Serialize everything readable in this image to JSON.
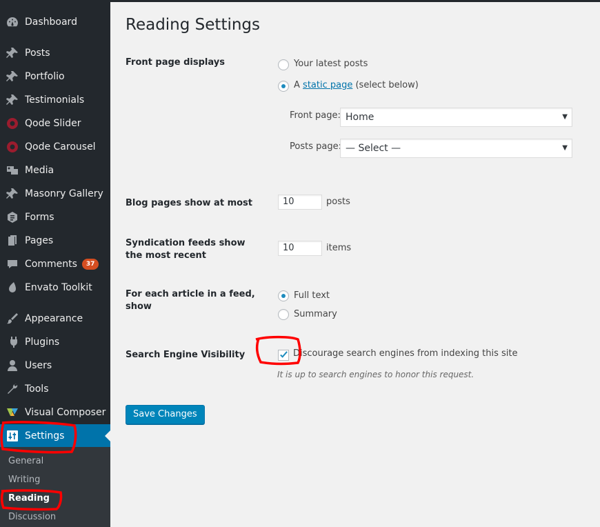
{
  "sidebar": {
    "items": [
      {
        "label": "Dashboard",
        "icon": "dashboard-icon"
      },
      {
        "label": "Posts",
        "icon": "pin-icon"
      },
      {
        "label": "Portfolio",
        "icon": "pin-icon"
      },
      {
        "label": "Testimonials",
        "icon": "pin-icon"
      },
      {
        "label": "Qode Slider",
        "icon": "circle-icon"
      },
      {
        "label": "Qode Carousel",
        "icon": "circle-icon"
      },
      {
        "label": "Media",
        "icon": "media-icon"
      },
      {
        "label": "Masonry Gallery",
        "icon": "pin-icon"
      },
      {
        "label": "Forms",
        "icon": "forms-icon"
      },
      {
        "label": "Pages",
        "icon": "pages-icon"
      },
      {
        "label": "Comments",
        "icon": "comment-icon",
        "badge": "37"
      },
      {
        "label": "Envato Toolkit",
        "icon": "leaf-icon"
      },
      {
        "label": "Appearance",
        "icon": "brush-icon"
      },
      {
        "label": "Plugins",
        "icon": "plugin-icon"
      },
      {
        "label": "Users",
        "icon": "user-icon"
      },
      {
        "label": "Tools",
        "icon": "wrench-icon"
      },
      {
        "label": "Visual Composer",
        "icon": "vc-icon"
      },
      {
        "label": "Settings",
        "icon": "settings-icon",
        "active": true
      }
    ],
    "submenu": [
      "General",
      "Writing",
      "Reading",
      "Discussion"
    ],
    "current_submenu": "Reading"
  },
  "page": {
    "title": "Reading Settings",
    "front_page_displays": {
      "label": "Front page displays",
      "option_latest": "Your latest posts",
      "option_static_prefix": "A",
      "option_static_link": "static page",
      "option_static_suffix": "(select below)",
      "selected": "static",
      "front_page_label": "Front page:",
      "front_page_value": "Home",
      "posts_page_label": "Posts page:",
      "posts_page_value": "— Select —"
    },
    "blog_pages": {
      "label": "Blog pages show at most",
      "value": "10",
      "unit": "posts"
    },
    "syndication": {
      "label": "Syndication feeds show the most recent",
      "value": "10",
      "unit": "items"
    },
    "feed_article": {
      "label": "For each article in a feed, show",
      "option_full": "Full text",
      "option_summary": "Summary",
      "selected": "full"
    },
    "search_visibility": {
      "label": "Search Engine Visibility",
      "checkbox_label": "Discourage search engines from indexing this site",
      "checked": true,
      "description": "It is up to search engines to honor this request."
    },
    "save_button": "Save Changes"
  },
  "colors": {
    "sidebar_bg": "#23282d",
    "submenu_bg": "#32373c",
    "active_bg": "#0073aa",
    "button_bg": "#0085ba",
    "annotation": "#ff0000"
  }
}
